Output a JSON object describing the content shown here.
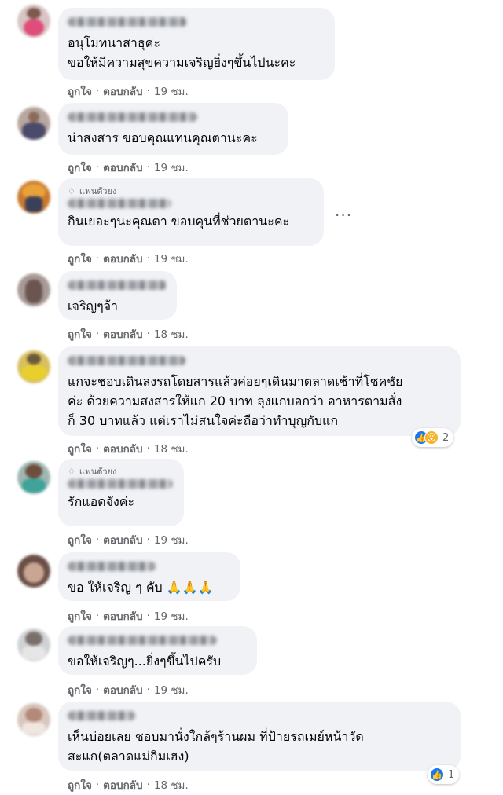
{
  "actions": {
    "like_label": "ถูกใจ",
    "reply_label": "ตอบกลับ",
    "separator": "·"
  },
  "colors": {
    "bubble": "#f0f2f5",
    "meta_text": "#65676b",
    "like_blue": "#1877f2",
    "wow_yellow": "#f7b125"
  },
  "comments": [
    {
      "text": "อนุโมทนาสาธุค่ะ\nขอให้มีความสุขความเจริญยิ่งๆขึ้นไปนะคะ",
      "time": "19 ชม."
    },
    {
      "text": "น่าสงสาร ขอบคุณแทนคุณตานะคะ",
      "time": "19 ชม."
    },
    {
      "badge": "แฟนตัวยง",
      "text": "กินเยอะๆนะคุณตา ขอบคุนที่ช่วยตานะคะ",
      "time": "19 ชม.",
      "more": "..."
    },
    {
      "text": "เจริญๆจ้า",
      "time": "18 ชม."
    },
    {
      "text": "แกจะชอบเดินลงรถโดยสารแล้วค่อยๆเดินมาตลาดเช้าที่โชคชัย\nค่ะ ด้วยความสงสารให้แก 20 บาท ลุงแกบอกว่า อาหารตามสั่ง\nก็ 30 บาทแล้ว แต่เราไม่สนใจค่ะถือว่าทำบุญกับแก",
      "time": "18 ชม.",
      "reactions": {
        "types": [
          "like-icon",
          "wow-icon"
        ],
        "count": "2"
      }
    },
    {
      "badge": "แฟนตัวยง",
      "text": "รักแอดจังค่ะ",
      "time": "19 ชม."
    },
    {
      "text": "ขอ ให้เจริญ ๆ คับ 🙏🙏🙏",
      "time": "19 ชม."
    },
    {
      "text": "ขอให้เจริญๆ...ยิ่งๆขึ้นไปครับ",
      "time": "19 ชม."
    },
    {
      "text": "เห็นบ่อยเลย ชอบมานั่งใกล้ๆร้านผม ที่ป้ายรถเมย์หน้าวัด\nสะแก(ตลาดแม่กิมเฮง)",
      "time": "18 ชม.",
      "reactions": {
        "types": [
          "like-icon"
        ],
        "count": "1"
      }
    }
  ]
}
